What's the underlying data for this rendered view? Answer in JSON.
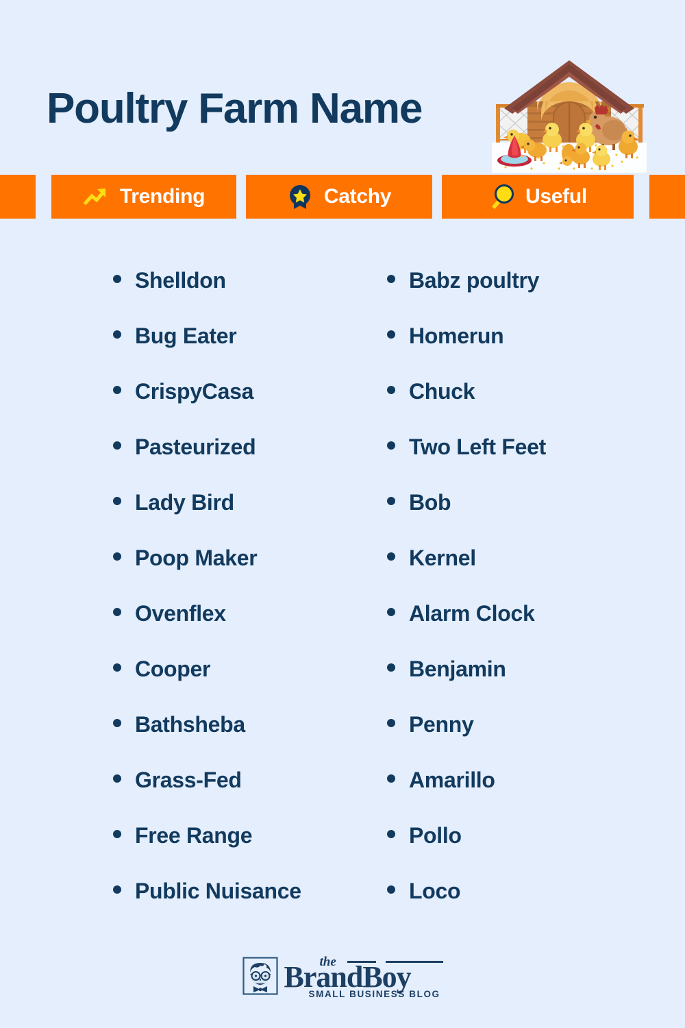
{
  "page": {
    "background_color": "#e4eefc",
    "accent_color": "#ff7300",
    "text_color": "#123a5e",
    "icon_yellow": "#ffdd15"
  },
  "header": {
    "title": "Poultry Farm Name",
    "illustration_name": "chicken-coop-illustration"
  },
  "badges": [
    {
      "label": "Trending",
      "icon": "trending-up-icon"
    },
    {
      "label": "Catchy",
      "icon": "award-badge-icon"
    },
    {
      "label": "Useful",
      "icon": "magnifier-icon"
    }
  ],
  "lists": {
    "left_column": [
      "Shelldon",
      "Bug Eater",
      "CrispyCasa",
      "Pasteurized",
      "Lady Bird",
      "Poop Maker",
      "Ovenflex",
      "Cooper",
      "Bathsheba",
      "Grass-Fed",
      "Free Range",
      "Public Nuisance"
    ],
    "right_column": [
      "Babz poultry",
      "Homerun",
      "Chuck",
      "Two Left Feet",
      "Bob",
      "Kernel",
      "Alarm Clock",
      "Benjamin",
      "Penny",
      "Amarillo",
      "Pollo",
      "Loco"
    ]
  },
  "footer": {
    "logo_the": "the",
    "logo_name": "BrandBoy",
    "logo_tagline": "SMALL BUSINESS BLOG",
    "logo_mark": "boy-face-icon"
  }
}
